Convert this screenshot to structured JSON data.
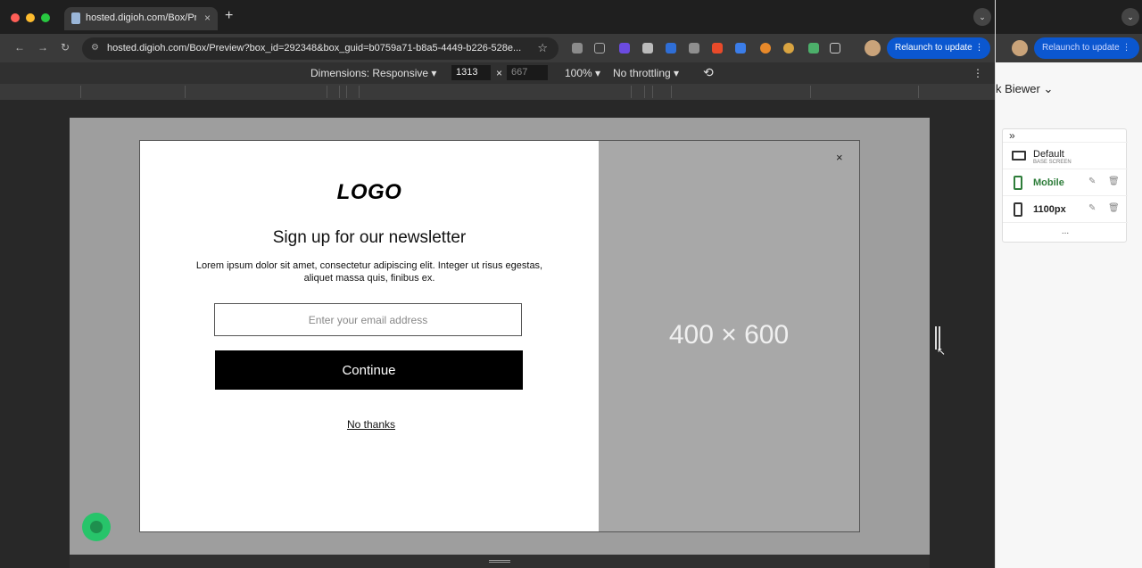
{
  "browser": {
    "tab_title": "hosted.digioh.com/Box/Previe",
    "tab_close": "×",
    "new_tab": "+",
    "tab_menu": "⌄",
    "url": "hosted.digioh.com/Box/Preview?box_id=292348&box_guid=b0759a71-b8a5-4449-b226-528e...",
    "relaunch_label": "Relaunch to update  ⋮"
  },
  "devtools": {
    "dimensions_label": "Dimensions: Responsive ▾",
    "width": "1313",
    "times": "×",
    "height": "667",
    "zoom": "100% ▾",
    "throttling": "No throttling ▾",
    "menu": "⋮"
  },
  "popup": {
    "logo": "LOGO",
    "heading": "Sign up for our newsletter",
    "description": "Lorem ipsum dolor sit amet, consectetur adipiscing elit. Integer ut risus egestas, aliquet massa quis, finibus ex.",
    "email_placeholder": "Enter your email address",
    "continue_label": "Continue",
    "no_thanks_label": "No thanks",
    "image_placeholder": "400 × 600",
    "close": "×"
  },
  "right_panel": {
    "relaunch_label": "Relaunch to update  ⋮",
    "user_name": "k Biewer  ⌄",
    "expand": "»",
    "screens": [
      {
        "name": "Default",
        "sub": "BASE SCREEN"
      },
      {
        "name": "Mobile"
      },
      {
        "name": "1100px"
      }
    ],
    "more": "...",
    "accent_color": "#2e7d3a"
  }
}
